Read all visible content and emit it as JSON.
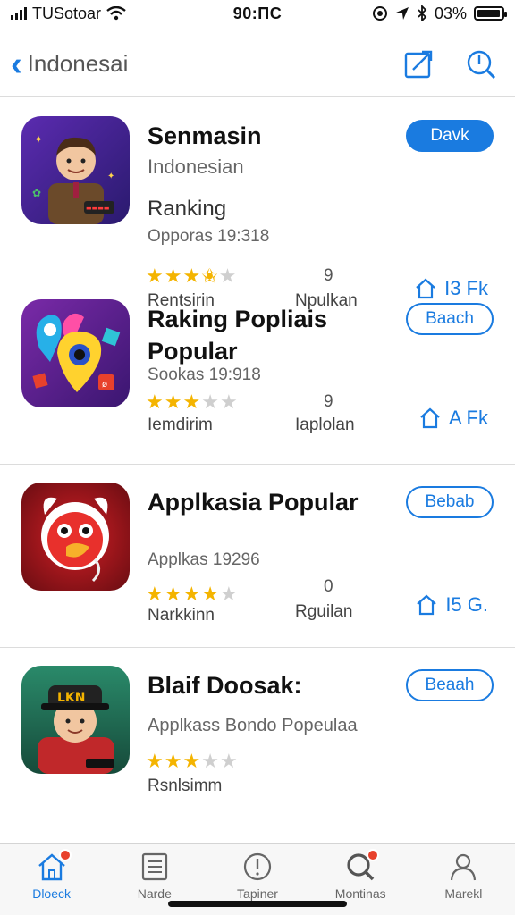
{
  "status_bar": {
    "carrier": "TUSotoar",
    "time": "90:ПС",
    "battery": "03%",
    "battery_level": 0.95
  },
  "nav": {
    "back_label": "Indonesai",
    "icons": [
      "edit-icon",
      "search-icon"
    ]
  },
  "apps": [
    {
      "name": "Senmasin",
      "subtitle": "Indonesian",
      "rank": "Ranking",
      "meta": "Opporas 19:318",
      "rating": 3.5,
      "rating_label": "Rentsirin",
      "count_value": "9",
      "count_label": "Npulkan",
      "button_label": "Davk",
      "size": "I3 Fk"
    },
    {
      "name": "Raking Popliais Popular",
      "meta": "Sookas 19:918",
      "rating": 3,
      "rating_label": "Iemdirim",
      "count_value": "9",
      "count_label": "Iaplolan",
      "button_label": "Baach",
      "size": "A Fk"
    },
    {
      "name": "Applkasia Popular",
      "meta": "Applkas 19296",
      "rating": 4,
      "rating_label": "Narkkinn",
      "count_value": "0",
      "count_label": "Rguilan",
      "button_label": "Bebab",
      "size": "I5 G."
    },
    {
      "name": "Blaif Doosak:",
      "meta": "Applkass Bondo Popeulaa",
      "rating": 3,
      "rating_label": "Rsnlsimm",
      "button_label": "Beaah"
    }
  ],
  "tabs": [
    {
      "label": "Dloeck",
      "icon": "home-icon",
      "badge": true
    },
    {
      "label": "Narde",
      "icon": "list-icon",
      "badge": false
    },
    {
      "label": "Tapiner",
      "icon": "info-icon",
      "badge": false
    },
    {
      "label": "Montinas",
      "icon": "search-icon",
      "badge": true
    },
    {
      "label": "Marekl",
      "icon": "person-icon",
      "badge": false
    }
  ],
  "colors": {
    "accent": "#1a7be0",
    "star": "#f4b400",
    "badge": "#e8412c"
  }
}
